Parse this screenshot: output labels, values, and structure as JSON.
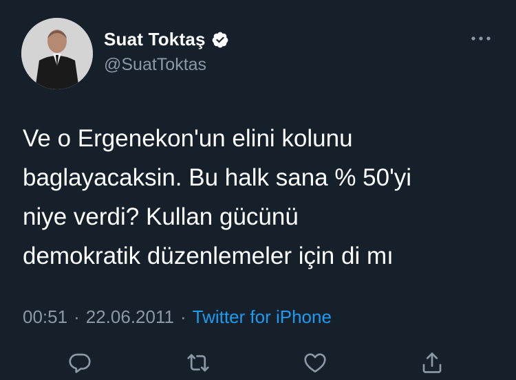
{
  "tweet": {
    "author_name": "Suat Toktaş",
    "author_handle": "@SuatToktas",
    "text": "Ve o Ergenekon'un elini kolunu\nbaglayacaksin. Bu halk sana % 50'yi\nniye verdi? Kullan gücünü\ndemokratik düzenlemeler için di mı",
    "time": "00:51",
    "separator": "·",
    "date": "22.06.2011",
    "source": "Twitter for iPhone"
  },
  "icons": {
    "verified": "verified-badge-icon",
    "more": "more-options-icon",
    "reply": "reply-icon",
    "retweet": "retweet-icon",
    "like": "like-icon",
    "share": "share-icon"
  },
  "colors": {
    "background": "#15202b",
    "secondary_text": "#8b98a5",
    "link": "#1d9bf0"
  }
}
